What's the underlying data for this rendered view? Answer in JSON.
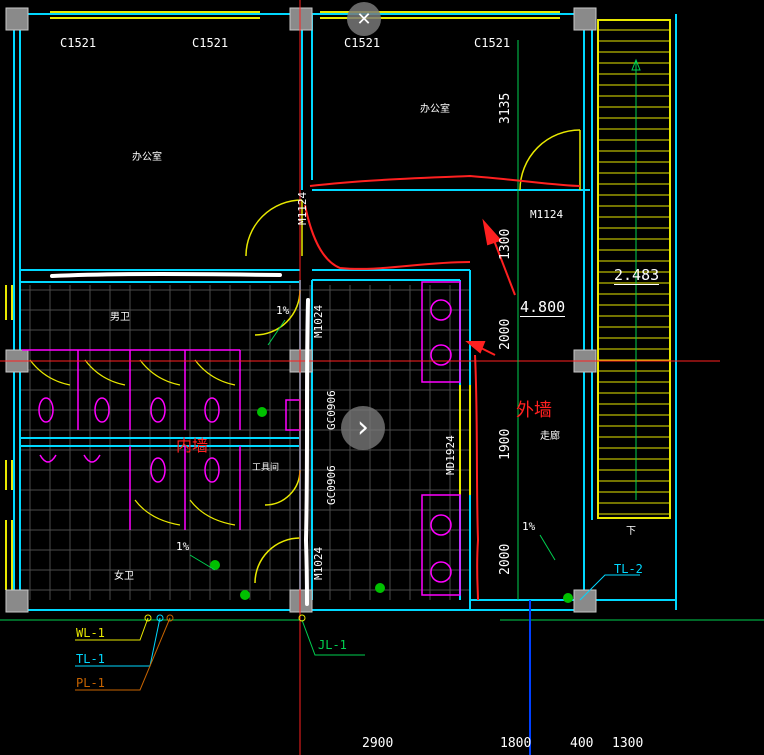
{
  "windows": [
    "C1521",
    "C1521",
    "C1521",
    "C1521"
  ],
  "rooms": {
    "top_left": "办公室",
    "top_right": "办公室",
    "men_wc": "男卫",
    "women_wc": "女卫",
    "tool_room": "工具间",
    "corridor": "走廊"
  },
  "doors": {
    "m1124_a": "M1124",
    "m1124_b": "M1124",
    "m1024_a": "M1024",
    "m1024_b": "M1024",
    "md1924": "MD1924",
    "gc0906_a": "GC0906",
    "gc0906_b": "GC0906"
  },
  "dimensions": {
    "d3135": "3135",
    "d1300": "1300",
    "d2000_a": "2000",
    "d1900": "1900",
    "d2000_b": "2000",
    "bottom": [
      "2900",
      "1800",
      "400",
      "1300"
    ]
  },
  "levels": {
    "stair": "2.483",
    "corridor": "4.800"
  },
  "slopes": [
    "1%",
    "1%",
    "1%"
  ],
  "stair_mark": "下",
  "pipe_labels": {
    "wl": "WL-1",
    "tl": "TL-1",
    "pl": "PL-1",
    "jl": "JL-1",
    "tl2": "TL-2"
  },
  "annotations": {
    "outer_wall": "外墙",
    "inner_wall": "内墙"
  },
  "controls": {
    "close_glyph": "✕",
    "next_glyph": "›"
  },
  "colors": {
    "wall": "#00d8ff",
    "window": "#e8e800",
    "door": "#e8e800",
    "column": "#8a8a8a",
    "fixture": "#ff00ff",
    "text": "#ffffff",
    "dimension": "#ffffff",
    "annotation_red": "#ff2020",
    "markup_white": "#ffffff",
    "tile": "#5a5a5a",
    "green_dot": "#00c000"
  }
}
